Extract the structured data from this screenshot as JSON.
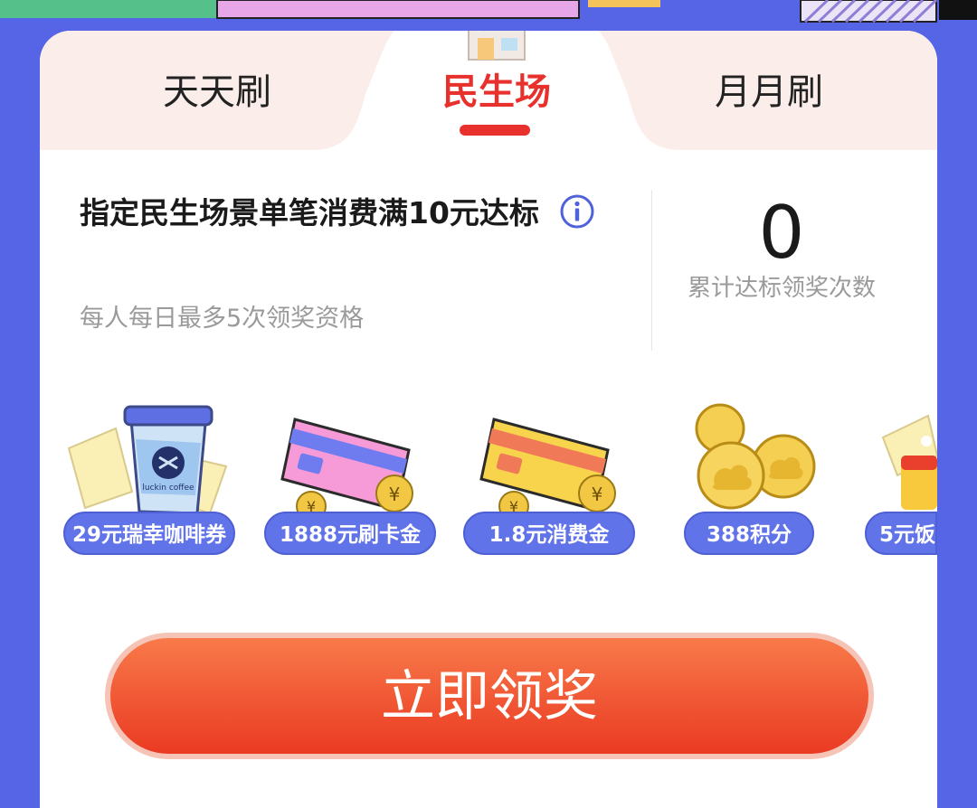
{
  "tabs": [
    {
      "label": "天天刷"
    },
    {
      "label": "民生场"
    },
    {
      "label": "月月刷"
    }
  ],
  "active_tab": "民生场",
  "task": {
    "title": "指定民生场景单笔消费满10元达标",
    "subtitle": "每人每日最多5次领奖资格"
  },
  "stats": {
    "count": "0",
    "label": "累计达标领奖次数"
  },
  "prizes": [
    {
      "label": "29元瑞幸咖啡券",
      "icon": "coffee-cup-icon"
    },
    {
      "label": "1888元刷卡金",
      "icon": "pink-card-icon"
    },
    {
      "label": "1.8元消费金",
      "icon": "yellow-card-icon"
    },
    {
      "label": "388积分",
      "icon": "gold-coins-icon"
    },
    {
      "label": "5元饭",
      "icon": "food-coupon-icon"
    }
  ],
  "claim_button": {
    "label": "立即领奖"
  },
  "colors": {
    "background": "#5665e6",
    "accent_red": "#e8312c",
    "pill_blue": "#6173e8",
    "button_gradient_top": "#f87a4a",
    "button_gradient_bottom": "#ea3a22"
  }
}
